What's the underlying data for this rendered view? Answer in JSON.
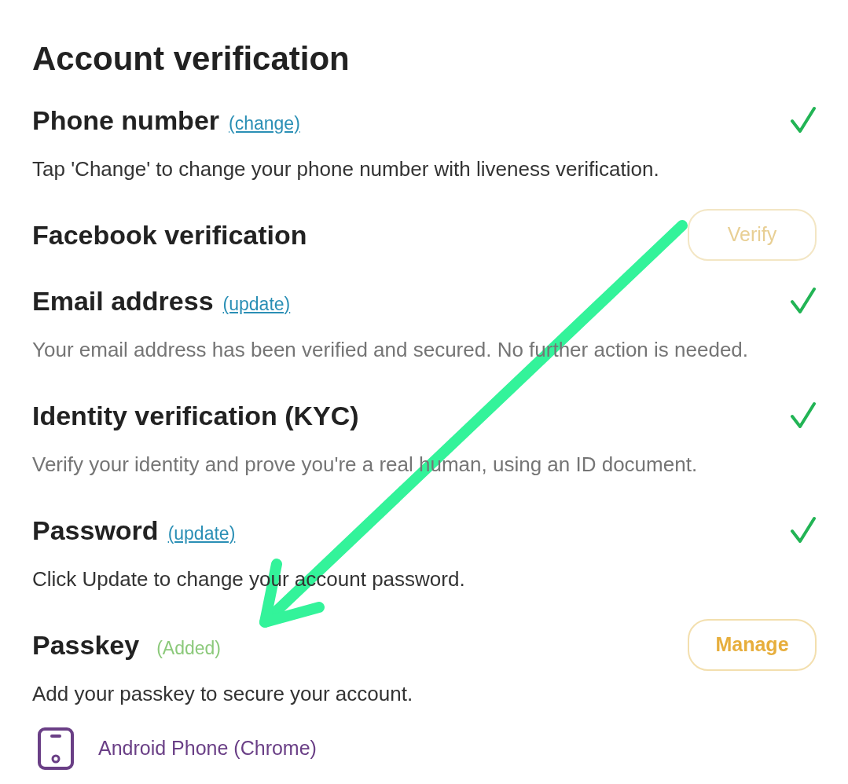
{
  "heading": "Account verification",
  "items": [
    {
      "title": "Phone number",
      "link": "(change)",
      "right": {
        "kind": "check"
      },
      "description": {
        "text": "Tap 'Change' to change your phone number with liveness verification.",
        "muted": false
      }
    },
    {
      "title": "Facebook verification",
      "right": {
        "kind": "button",
        "label": "Verify",
        "disabled": true
      }
    },
    {
      "title": "Email address",
      "link": "(update)",
      "right": {
        "kind": "check"
      },
      "description": {
        "text": "Your email address has been verified and secured. No further action is needed.",
        "muted": true
      }
    },
    {
      "title": "Identity verification (KYC)",
      "right": {
        "kind": "check"
      },
      "description": {
        "text": "Verify your identity and prove you're a real human, using an ID document.",
        "muted": true
      }
    },
    {
      "title": "Password",
      "link": "(update)",
      "right": {
        "kind": "check"
      },
      "description": {
        "text": "Click Update to change your account password.",
        "muted": false
      }
    },
    {
      "title": "Passkey",
      "status": "(Added)",
      "right": {
        "kind": "button",
        "label": "Manage",
        "disabled": false
      },
      "description": {
        "text": "Add your passkey to secure your account.",
        "muted": false
      }
    }
  ],
  "devices": [
    {
      "name": "Android Phone (Chrome)"
    }
  ]
}
